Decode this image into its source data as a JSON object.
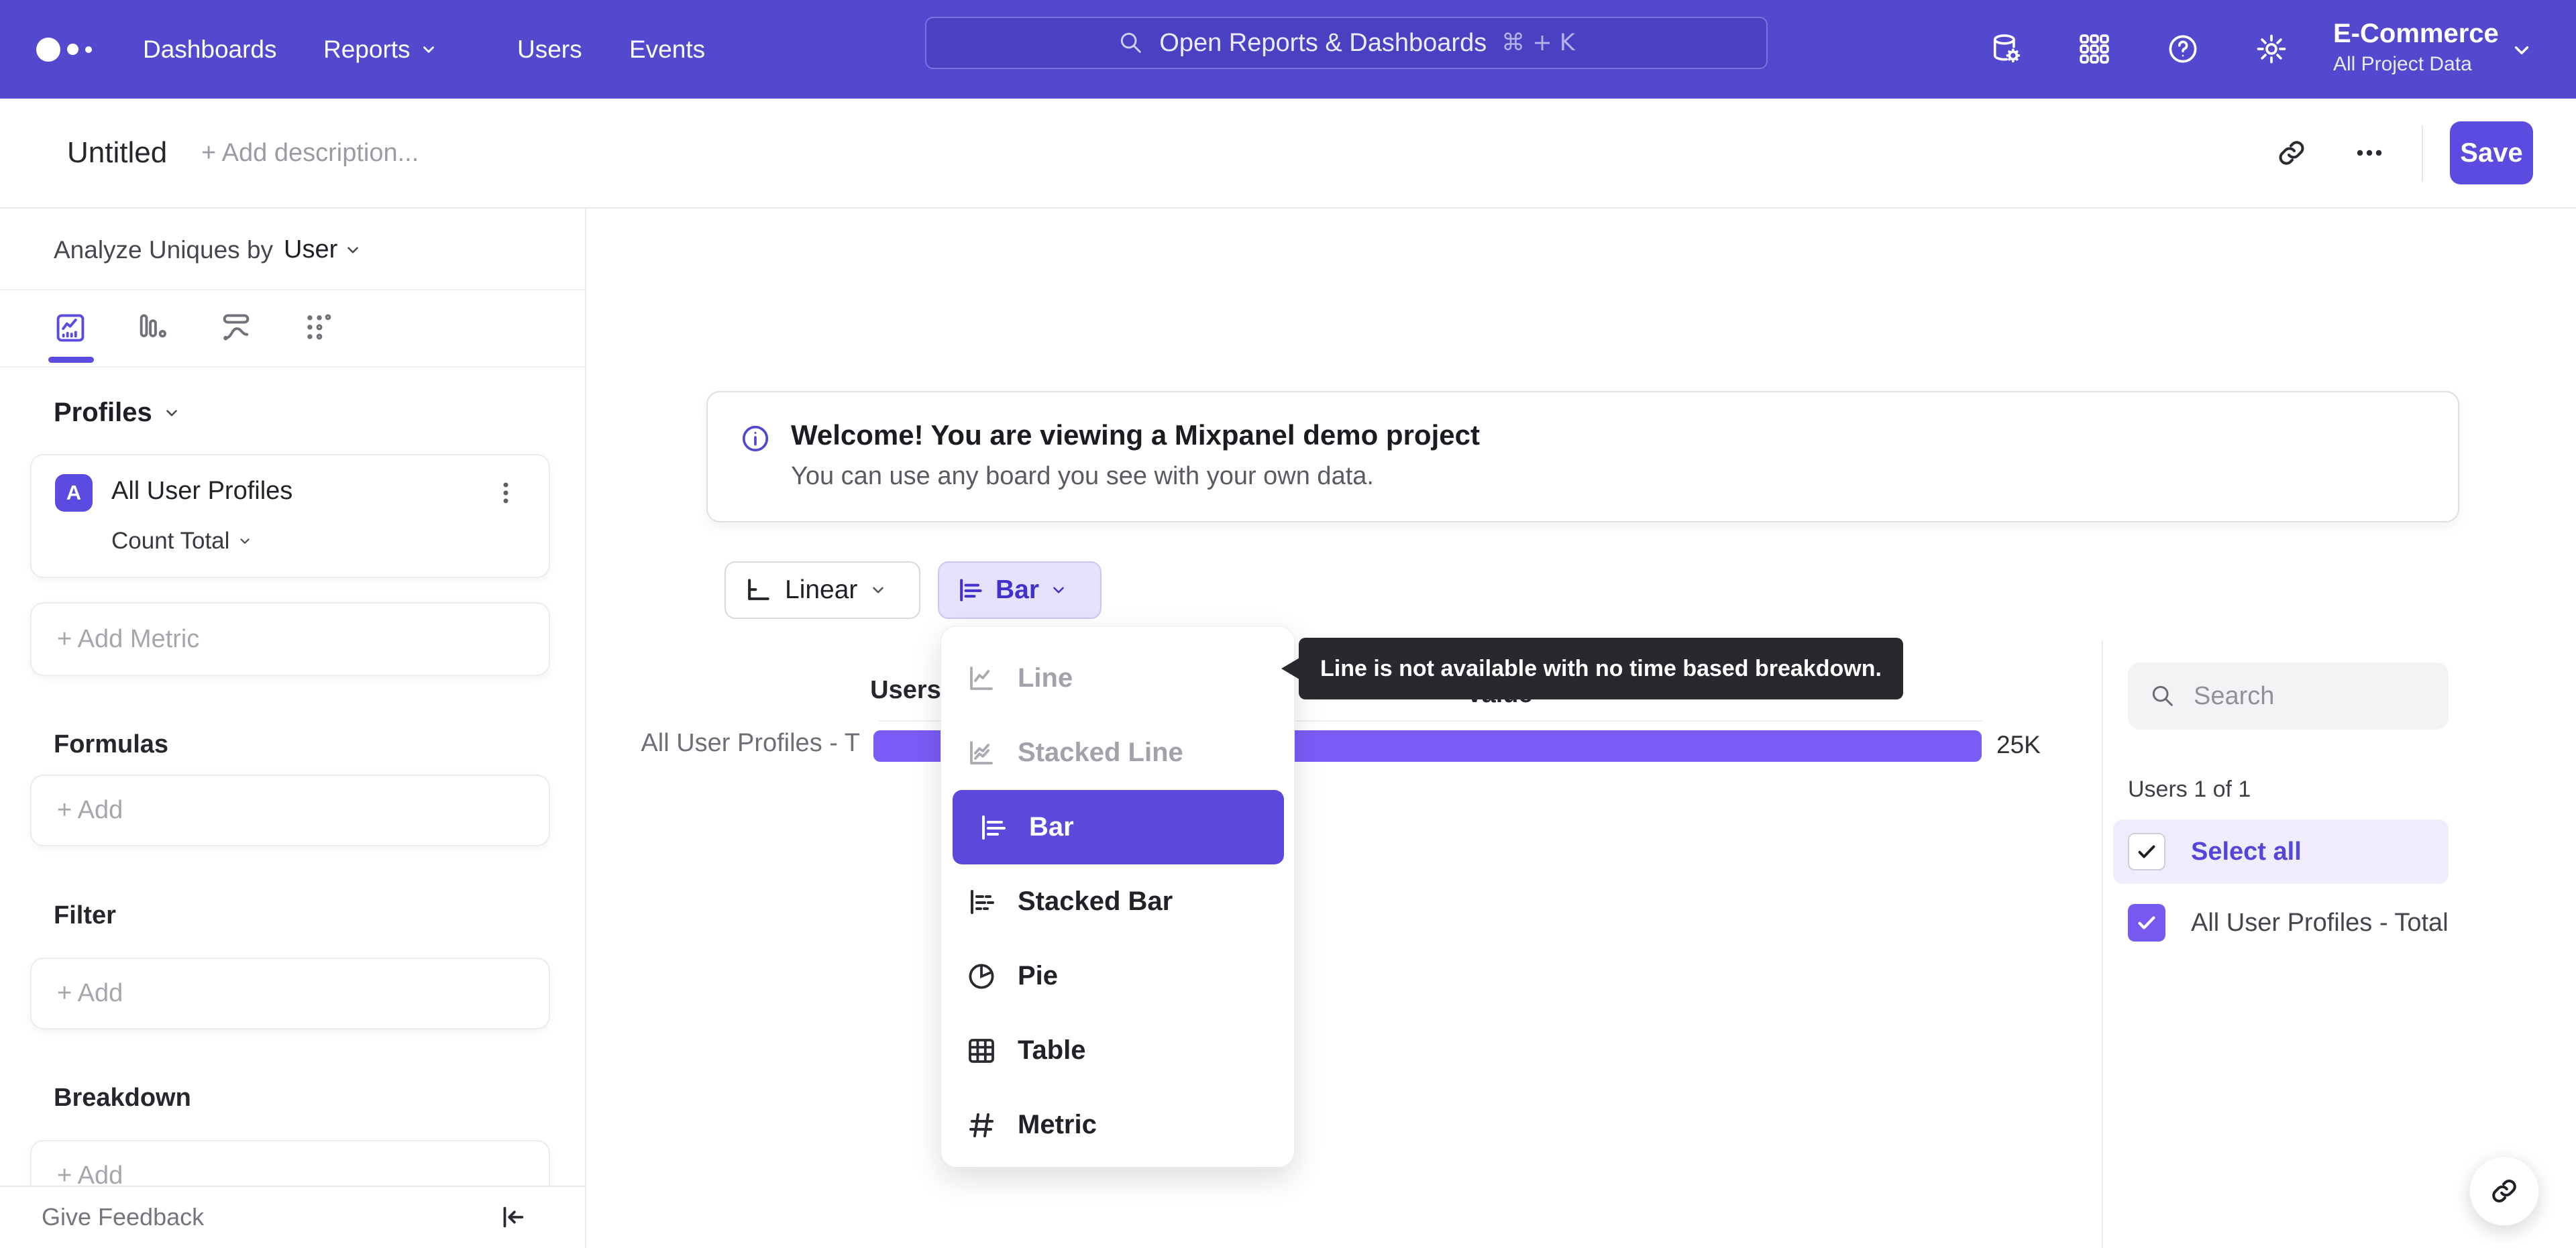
{
  "colors": {
    "nav_bg": "#5349ce",
    "accent": "#5b4be0",
    "bar_fill": "#7a5cf6",
    "selected_menu_bg": "#5b49dc",
    "checkbox_fill": "#7659f0",
    "tooltip_bg": "#28282e"
  },
  "nav": {
    "items": [
      {
        "label": "Dashboards"
      },
      {
        "label": "Reports"
      },
      {
        "label": "Users"
      },
      {
        "label": "Events"
      }
    ],
    "search_placeholder": "Open Reports & Dashboards",
    "search_shortcut": "⌘ + K",
    "project_name": "E-Commerce",
    "project_scope": "All Project Data"
  },
  "header": {
    "title": "Untitled",
    "description_placeholder": "+ Add description...",
    "save_label": "Save"
  },
  "sidebar": {
    "analyze_label": "Analyze Uniques by",
    "analyze_value": "User",
    "profiles_label": "Profiles",
    "metric": {
      "badge": "A",
      "name": "All User Profiles",
      "aggregation": "Count Total"
    },
    "add_metric_label": "+ Add Metric",
    "sections": [
      {
        "title": "Formulas",
        "add_label": "+ Add"
      },
      {
        "title": "Filter",
        "add_label": "+ Add"
      },
      {
        "title": "Breakdown",
        "add_label": "+ Add"
      }
    ],
    "feedback_label": "Give Feedback"
  },
  "main": {
    "banner": {
      "title": "Welcome! You are viewing a Mixpanel demo project",
      "subtitle": "You can use any board you see with your own data."
    },
    "controls": {
      "time_label": "Linear",
      "chart_type_label": "Bar"
    },
    "menu": {
      "items": [
        {
          "label": "Line",
          "state": "disabled"
        },
        {
          "label": "Stacked Line",
          "state": "disabled"
        },
        {
          "label": "Bar",
          "state": "selected"
        },
        {
          "label": "Stacked Bar",
          "state": "normal"
        },
        {
          "label": "Pie",
          "state": "normal"
        },
        {
          "label": "Table",
          "state": "normal"
        },
        {
          "label": "Metric",
          "state": "normal"
        }
      ]
    },
    "tooltip": "Line is not available with no time based breakdown.",
    "chart_header": {
      "users": "Users",
      "value": "Value"
    },
    "chart_row": {
      "label": "All User Profiles - T",
      "value_label": "25K"
    }
  },
  "chart_data": {
    "type": "bar",
    "orientation": "horizontal",
    "columns": [
      "Users",
      "Value"
    ],
    "categories": [
      "All User Profiles - Total"
    ],
    "values": [
      25000
    ],
    "value_labels": [
      "25K"
    ],
    "bar_color": "#7a5cf6",
    "xlim": [
      0,
      25000
    ]
  },
  "legend": {
    "search_placeholder": "Search",
    "count_label": "Users 1 of 1",
    "select_all_label": "Select all",
    "items": [
      {
        "label": "All User Profiles - Total",
        "checked": true
      }
    ]
  }
}
